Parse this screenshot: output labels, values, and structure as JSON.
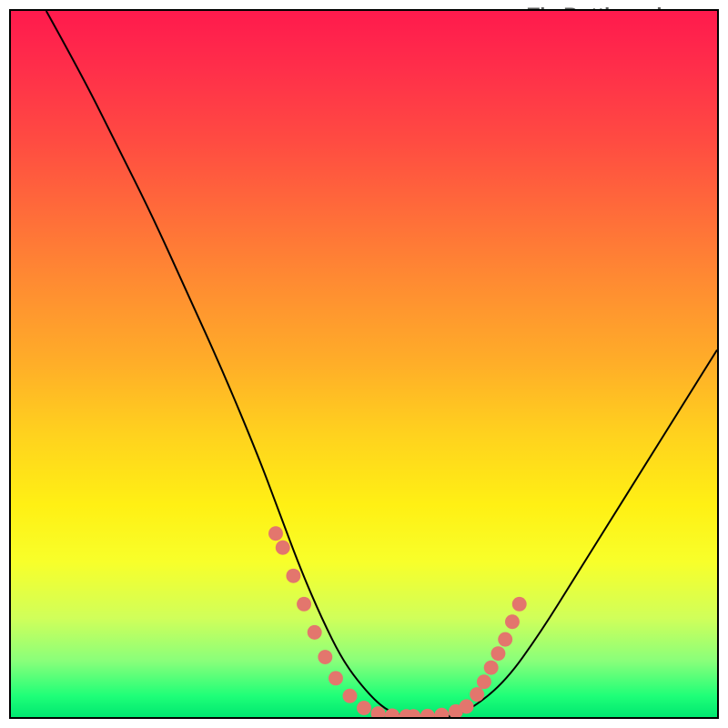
{
  "watermark": "TheBottleneck.com",
  "chart_data": {
    "type": "line",
    "title": "",
    "xlabel": "",
    "ylabel": "",
    "xlim": [
      0,
      100
    ],
    "ylim": [
      0,
      100
    ],
    "grid": false,
    "legend": false,
    "series": [
      {
        "name": "bottleneck-curve",
        "x": [
          5,
          10,
          15,
          20,
          25,
          30,
          35,
          38,
          41,
          44,
          47,
          50,
          53,
          56,
          59,
          62,
          65,
          70,
          75,
          80,
          85,
          90,
          95,
          100
        ],
        "y": [
          100,
          91,
          81,
          71,
          60,
          49,
          37,
          29,
          21,
          14,
          8,
          4,
          1,
          0,
          0,
          0,
          1,
          5,
          12,
          20,
          28,
          36,
          44,
          52
        ]
      }
    ],
    "markers": {
      "name": "bottleneck-marker-cluster",
      "color": "#e3766d",
      "points": [
        {
          "x": 37.5,
          "y": 26
        },
        {
          "x": 38.5,
          "y": 24
        },
        {
          "x": 40.0,
          "y": 20
        },
        {
          "x": 41.5,
          "y": 16
        },
        {
          "x": 43.0,
          "y": 12
        },
        {
          "x": 44.5,
          "y": 8.5
        },
        {
          "x": 46.0,
          "y": 5.5
        },
        {
          "x": 48.0,
          "y": 3
        },
        {
          "x": 50.0,
          "y": 1.3
        },
        {
          "x": 52.0,
          "y": 0.5
        },
        {
          "x": 54.0,
          "y": 0.2
        },
        {
          "x": 56.0,
          "y": 0.1
        },
        {
          "x": 57.0,
          "y": 0.1
        },
        {
          "x": 59.0,
          "y": 0.15
        },
        {
          "x": 61.0,
          "y": 0.3
        },
        {
          "x": 63.0,
          "y": 0.8
        },
        {
          "x": 64.5,
          "y": 1.5
        },
        {
          "x": 66.0,
          "y": 3.2
        },
        {
          "x": 67.0,
          "y": 5
        },
        {
          "x": 68.0,
          "y": 7
        },
        {
          "x": 69.0,
          "y": 9
        },
        {
          "x": 70.0,
          "y": 11
        },
        {
          "x": 71.0,
          "y": 13.5
        },
        {
          "x": 72.0,
          "y": 16
        }
      ]
    }
  }
}
